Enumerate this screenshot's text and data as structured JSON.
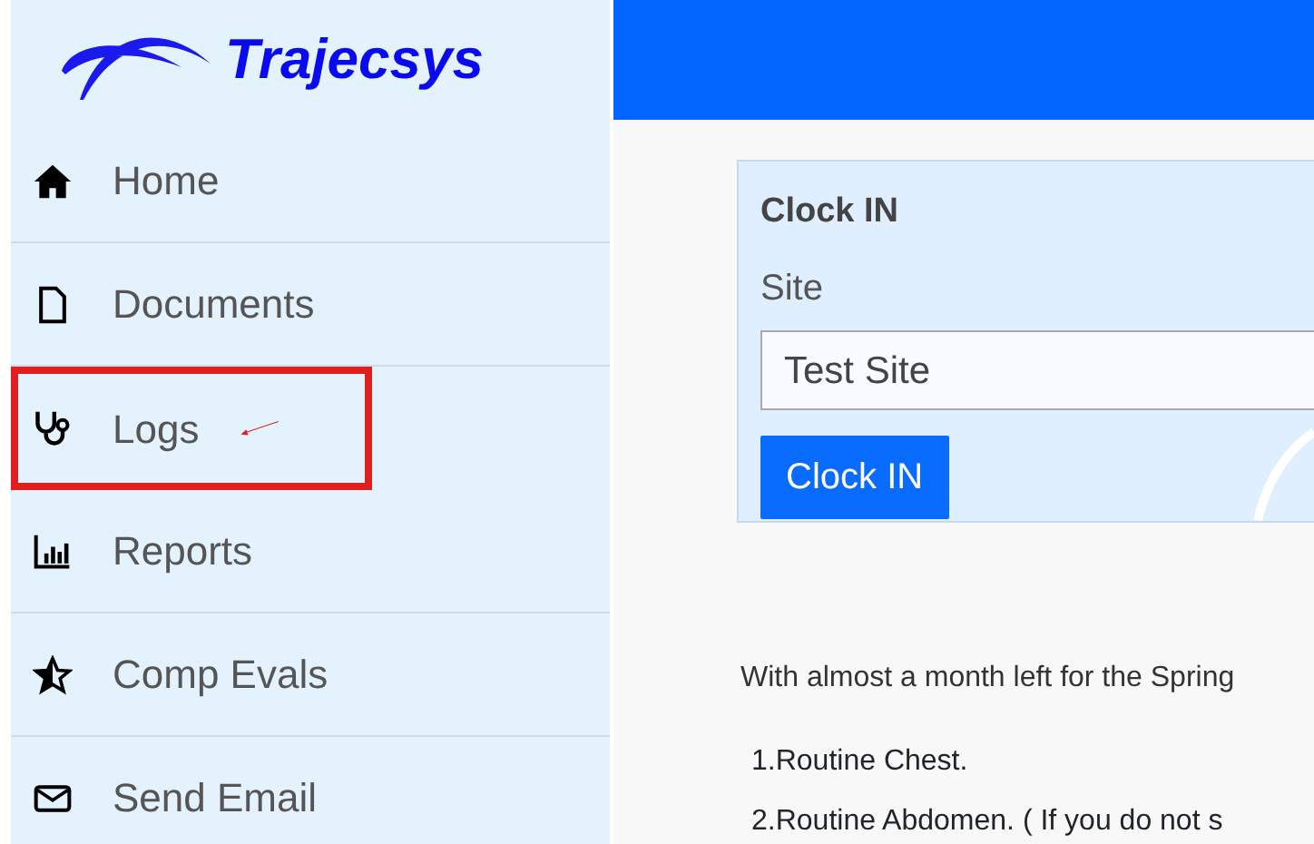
{
  "logo": {
    "text": "Trajecsys"
  },
  "sidebar": {
    "items": [
      {
        "label": "Home",
        "highlighted": false
      },
      {
        "label": "Documents",
        "highlighted": false
      },
      {
        "label": "Logs",
        "highlighted": true
      },
      {
        "label": "Reports",
        "highlighted": false
      },
      {
        "label": "Comp Evals",
        "highlighted": false
      },
      {
        "label": "Send Email",
        "highlighted": false
      }
    ]
  },
  "clock_in": {
    "title": "Clock IN",
    "site_label": "Site",
    "site_value": "Test Site",
    "button": "Clock IN"
  },
  "message": "With almost a month left for the Spring",
  "list": [
    {
      "number": "1.",
      "text": "Routine Chest."
    },
    {
      "number": "2.",
      "text": "Routine Abdomen. ( If you do not s"
    }
  ]
}
